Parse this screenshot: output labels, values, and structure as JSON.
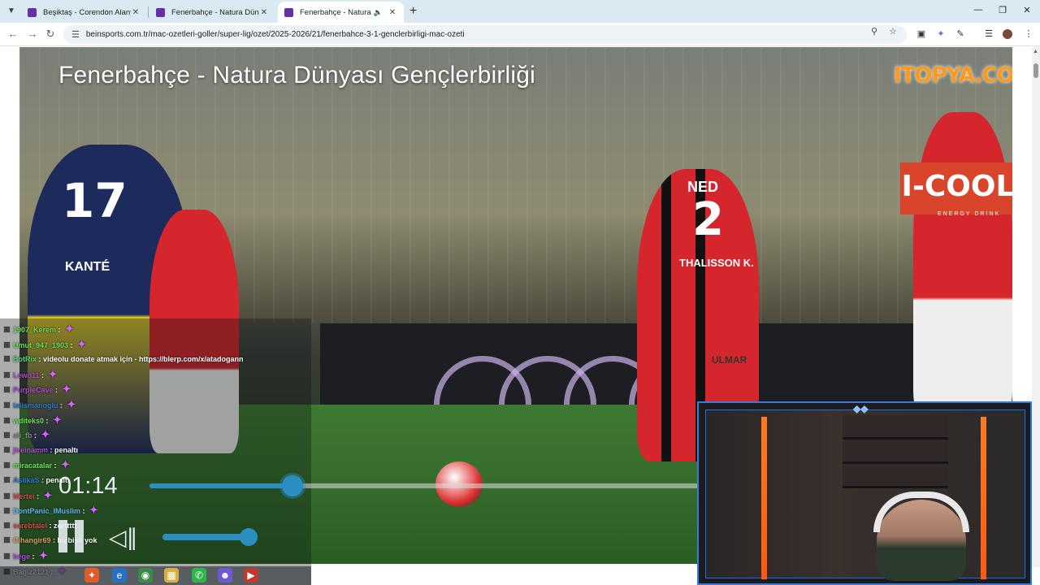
{
  "browser": {
    "tabs": [
      {
        "title": "Beşiktaş - Corendon Alanyaspor",
        "active": false
      },
      {
        "title": "Fenerbahçe - Natura Dünyası Gençlerbirliği",
        "active": false
      },
      {
        "title": "Fenerbahçe - Natura Dünyası Gençlerbirliği",
        "active": true
      }
    ],
    "url": "beinsports.com.tr/mac-ozetleri-goller/super-lig/ozet/2025-2026/21/fenerbahce-3-1-genclerbirligi-mac-ozeti",
    "icons": {
      "tab_list": "chevron-down-icon",
      "new_tab": "plus-icon",
      "back": "back-arrow-icon",
      "forward": "forward-arrow-icon",
      "reload": "reload-icon",
      "site_info": "tune-icon",
      "zoom": "zoom-icon",
      "bookmark": "star-icon",
      "minimize": "minimize-icon",
      "restore": "restore-icon",
      "close": "close-icon"
    }
  },
  "video": {
    "title": "Fenerbahçe - Natura Dünyası Gençlerbirliği",
    "watermark": "ITOPYA.COM",
    "sponsor": "I-COOL",
    "sponsor_sub": "ENERGY DRINK",
    "jersey_17": "17",
    "jersey_17_name": "KANTÉ",
    "jersey_2": "2",
    "jersey_2_name": "THALISSON K.",
    "jersey_brand": "NED",
    "shorts_brand": "ULMAR",
    "time": "01:14",
    "seek_progress": 0.26,
    "volume": 0.95
  },
  "chat": {
    "messages": [
      {
        "user": "1907_Kerem",
        "user_color": "#6ee05a",
        "text": "",
        "emote": true
      },
      {
        "user": "Umut_947_1903",
        "user_color": "#6ee05a",
        "text": "",
        "emote": true
      },
      {
        "user": "BotRix",
        "user_color": "#5ad17a",
        "text": "videolu donate atmak için - https://blerp.com/x/atadogann",
        "emote": false
      },
      {
        "user": "Lewo11",
        "user_color": "#b04ad6",
        "text": "",
        "emote": true
      },
      {
        "user": "PurpleCave",
        "user_color": "#b04ad6",
        "text": "",
        "emote": true
      },
      {
        "user": "talismanoglu",
        "user_color": "#2e7bd0",
        "text": "",
        "emote": true
      },
      {
        "user": "wditeks0",
        "user_color": "#6ee05a",
        "text": "",
        "emote": true
      },
      {
        "user": "ali_fb",
        "user_color": "#8a8a8a",
        "text": "",
        "emote": true
      },
      {
        "user": "jtreinamm",
        "user_color": "#b04ad6",
        "text": "penaltı",
        "emote": false
      },
      {
        "user": "miracatalar",
        "user_color": "#6ee05a",
        "text": "",
        "emote": true
      },
      {
        "user": "AslikaS",
        "user_color": "#2e7bd0",
        "text": "penaltı",
        "emote": false
      },
      {
        "user": "Mertei",
        "user_color": "#d44b4b",
        "text": "",
        "emote": true
      },
      {
        "user": "DontPanic_IMuslim",
        "user_color": "#5ab8f0",
        "text": "",
        "emote": true
      },
      {
        "user": "sarebtalel",
        "user_color": "#d44b4b",
        "text": "zorttttt",
        "emote": false
      },
      {
        "user": "Cihangir69",
        "user_color": "#d0a060",
        "text": "hiçbişe yok",
        "emote": false
      },
      {
        "user": "bege",
        "user_color": "#b04ad6",
        "text": "",
        "emote": true
      },
      {
        "user": "Bagiz2121",
        "user_color": "#e8e8e8",
        "text": "",
        "emote": true
      }
    ]
  },
  "colors": {
    "accent": "#2a8fc0",
    "tab_strip": "#dbe9f3",
    "webcam_border": "#3b7bd6",
    "cam_light": "#ff7a22"
  }
}
